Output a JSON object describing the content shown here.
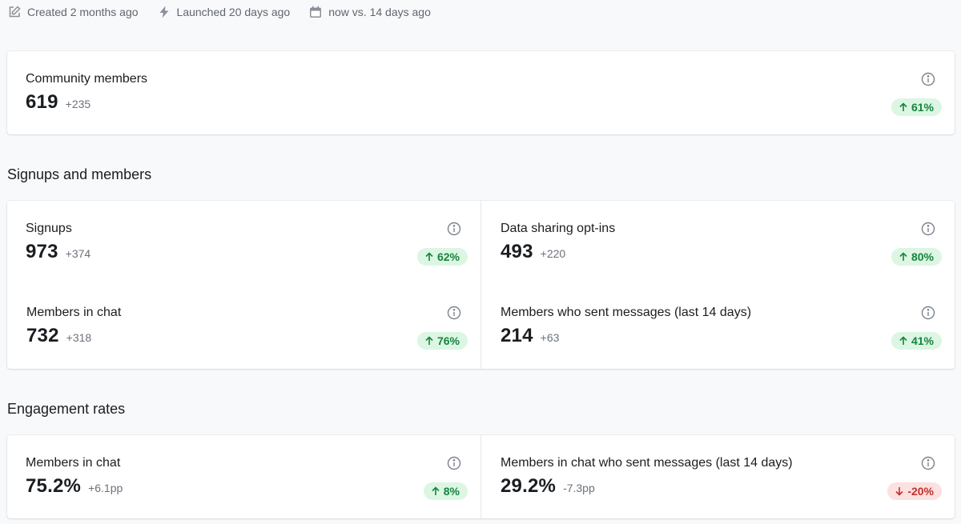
{
  "meta": {
    "created": "Created 2 months ago",
    "launched": "Launched 20 days ago",
    "period": "now vs. 14 days ago"
  },
  "community": {
    "label": "Community members",
    "value": "619",
    "delta": "+235",
    "change": "61%",
    "direction": "up"
  },
  "sections": {
    "signups_title": "Signups and members",
    "engagement_title": "Engagement rates"
  },
  "signups": {
    "label": "Signups",
    "value": "973",
    "delta": "+374",
    "change": "62%",
    "direction": "up"
  },
  "data_sharing": {
    "label": "Data sharing opt-ins",
    "value": "493",
    "delta": "+220",
    "change": "80%",
    "direction": "up"
  },
  "members_in_chat": {
    "label": "Members in chat",
    "value": "732",
    "delta": "+318",
    "change": "76%",
    "direction": "up"
  },
  "members_sent": {
    "label": "Members who sent messages (last 14 days)",
    "value": "214",
    "delta": "+63",
    "change": "41%",
    "direction": "up"
  },
  "rate_in_chat": {
    "label": "Members in chat",
    "value": "75.2%",
    "delta": "+6.1pp",
    "change": "8%",
    "direction": "up"
  },
  "rate_sent": {
    "label": "Members in chat who sent messages (last 14 days)",
    "value": "29.2%",
    "delta": "-7.3pp",
    "change": "-20%",
    "direction": "down"
  },
  "colors": {
    "up_bg": "#dcf6e3",
    "up_fg": "#16843e",
    "down_bg": "#fde0e0",
    "down_fg": "#c0312b"
  }
}
